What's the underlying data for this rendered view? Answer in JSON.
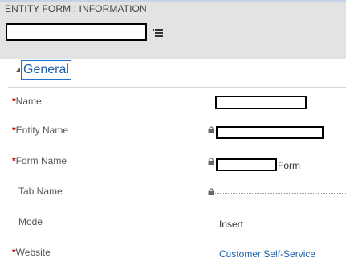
{
  "header": {
    "entity_title": "ENTITY FORM : INFORMATION",
    "record_name": ""
  },
  "section": {
    "title": "General",
    "expanded": true
  },
  "fields": {
    "name": {
      "label": "Name",
      "required_mark": "*",
      "value": ""
    },
    "entity_name": {
      "label": "Entity Name",
      "required_mark": "*",
      "value": "",
      "locked": true
    },
    "form_name": {
      "label": "Form Name",
      "required_mark": "*",
      "value_suffix": "Form",
      "locked": true
    },
    "tab_name": {
      "label": "Tab Name",
      "value": "",
      "locked": true
    },
    "mode": {
      "label": "Mode",
      "value": "Insert"
    },
    "website": {
      "label": "Website",
      "required_mark": "*",
      "value": "Customer Self-Service"
    }
  },
  "icons": {
    "menu": "menu-icon",
    "lock": "lock-icon",
    "collapse": "collapse-arrow-icon"
  },
  "colors": {
    "header_bg": "#e3e3e3",
    "accent": "#1d5fae",
    "required": "#c00000"
  }
}
